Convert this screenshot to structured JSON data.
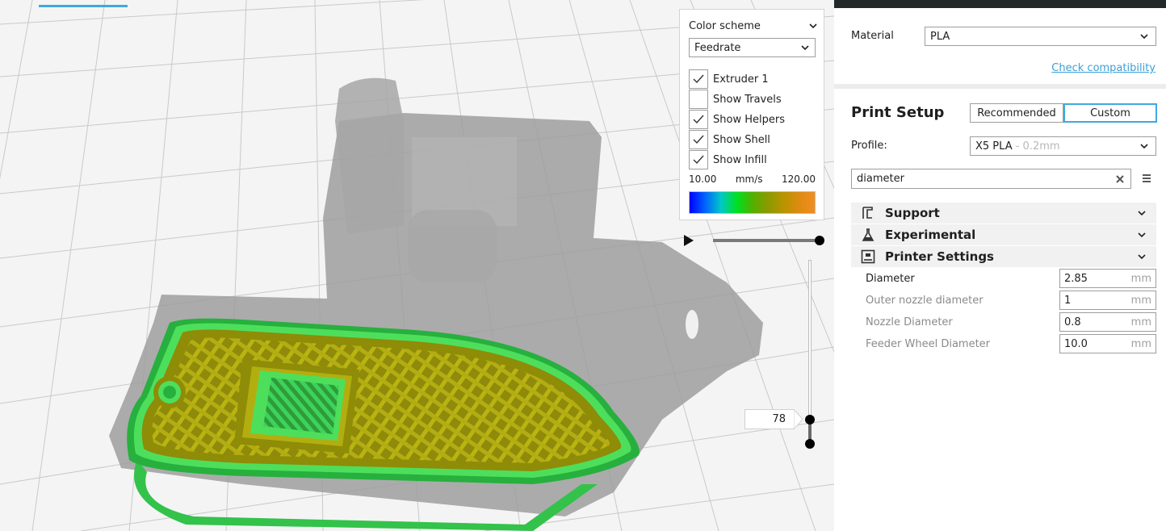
{
  "viewport": {
    "layer_value": "78"
  },
  "color_panel": {
    "title": "Color scheme",
    "selected_scheme": "Feedrate",
    "checkboxes": [
      {
        "label": "Extruder 1",
        "checked": true
      },
      {
        "label": "Show Travels",
        "checked": false
      },
      {
        "label": "Show Helpers",
        "checked": true
      },
      {
        "label": "Show Shell",
        "checked": true
      },
      {
        "label": "Show Infill",
        "checked": true
      }
    ],
    "scale_min": "10.00",
    "scale_unit": "mm/s",
    "scale_max": "120.00"
  },
  "sidebar": {
    "material_label": "Material",
    "material_value": "PLA",
    "check_compat": "Check compatibility",
    "print_setup_title": "Print Setup",
    "mode_recommended": "Recommended",
    "mode_custom": "Custom",
    "profile_label": "Profile:",
    "profile_value": "X5 PLA",
    "profile_sub": " - 0.2mm",
    "search_value": "diameter",
    "categories": [
      {
        "label": "Support",
        "icon": "support-icon"
      },
      {
        "label": "Experimental",
        "icon": "flask-icon"
      },
      {
        "label": "Printer Settings",
        "icon": "printer-icon"
      }
    ],
    "settings": [
      {
        "label": "Diameter",
        "value": "2.85",
        "unit": "mm"
      },
      {
        "label": "Outer nozzle diameter",
        "value": "1",
        "unit": "mm"
      },
      {
        "label": "Nozzle Diameter",
        "value": "0.8",
        "unit": "mm"
      },
      {
        "label": "Feeder Wheel Diameter",
        "value": "10.0",
        "unit": "mm"
      }
    ]
  }
}
